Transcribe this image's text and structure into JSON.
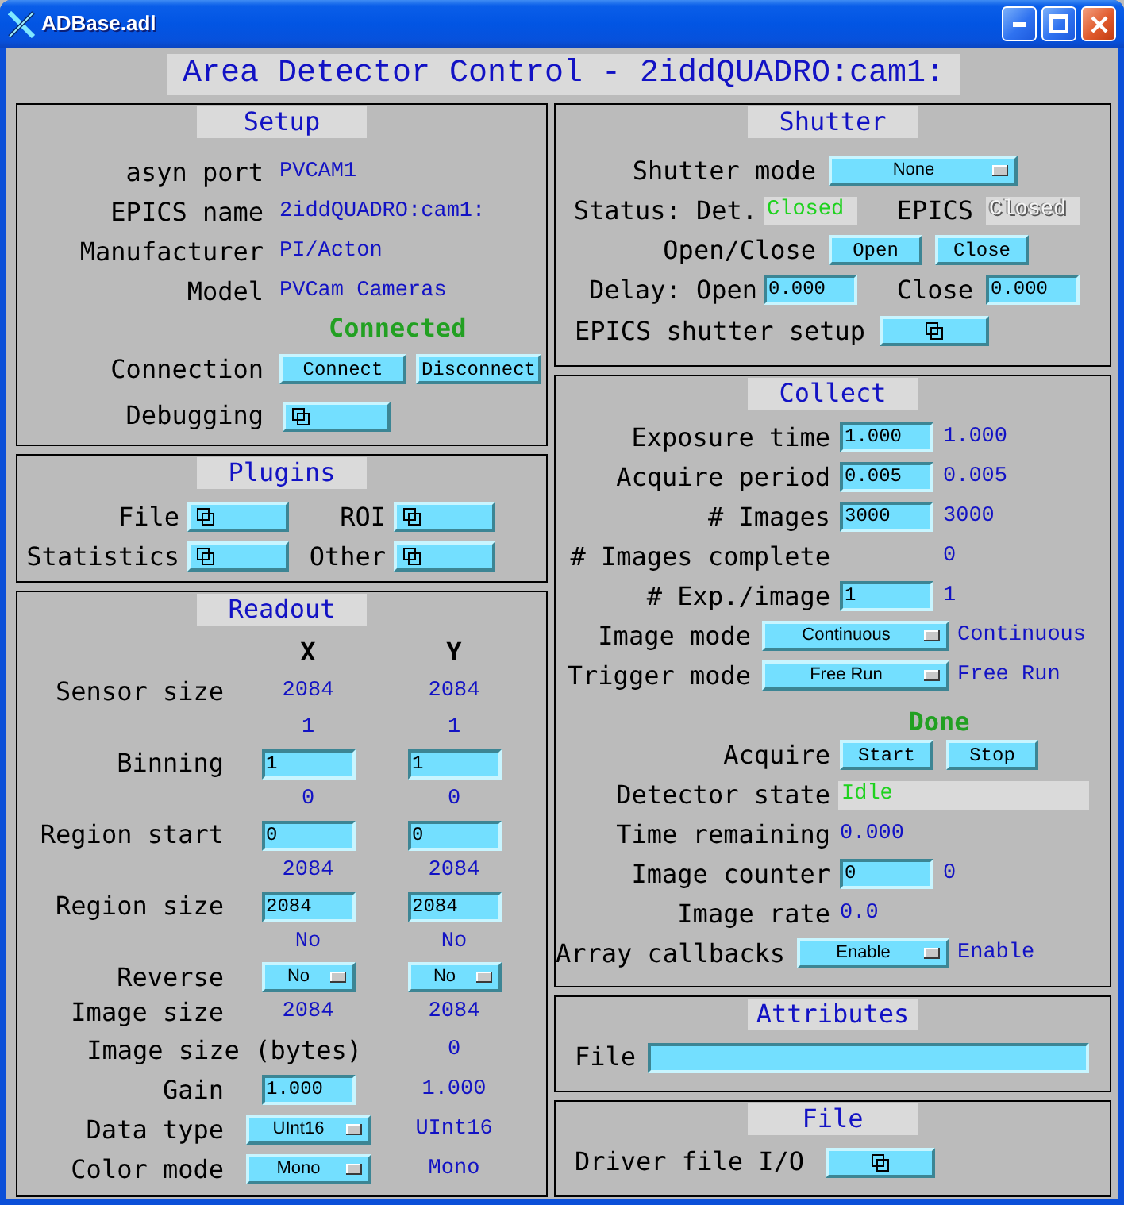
{
  "window": {
    "title": "ADBase.adl"
  },
  "display_title": "Area Detector Control - 2iddQUADRO:cam1:",
  "setup": {
    "title": "Setup",
    "rows": [
      {
        "kind": "value",
        "label": "asyn port",
        "value": "PVCAM1"
      },
      {
        "kind": "value",
        "label": "EPICS name",
        "value": "2iddQUADRO:cam1:"
      },
      {
        "kind": "value",
        "label": "Manufacturer",
        "value": "PI/Acton"
      },
      {
        "kind": "value",
        "label": "Model",
        "value": "PVCam Cameras"
      },
      {
        "kind": "status",
        "value": "Connected"
      },
      {
        "kind": "buttons",
        "label": "Connection",
        "buttons": [
          "Connect",
          "Disconnect"
        ]
      },
      {
        "kind": "related",
        "label": "Debugging"
      }
    ]
  },
  "plugins": {
    "title": "Plugins",
    "items": [
      {
        "label": "File"
      },
      {
        "label": "ROI"
      },
      {
        "label": "Statistics"
      },
      {
        "label": "Other"
      }
    ]
  },
  "readout": {
    "title": "Readout",
    "columns": [
      "X",
      "Y"
    ],
    "rows": [
      {
        "kind": "value",
        "label": "Sensor size",
        "values": [
          "2084",
          "2084"
        ]
      },
      {
        "kind": "readback",
        "values": [
          "1",
          "1"
        ]
      },
      {
        "kind": "field",
        "label": "Binning",
        "values": [
          "1",
          "1"
        ]
      },
      {
        "kind": "readback",
        "values": [
          "0",
          "0"
        ]
      },
      {
        "kind": "field",
        "label": "Region start",
        "values": [
          "0",
          "0"
        ]
      },
      {
        "kind": "readback",
        "values": [
          "2084",
          "2084"
        ]
      },
      {
        "kind": "field",
        "label": "Region size",
        "values": [
          "2084",
          "2084"
        ]
      },
      {
        "kind": "readback",
        "values": [
          "No",
          "No"
        ]
      },
      {
        "kind": "menu",
        "label": "Reverse",
        "values": [
          "No",
          "No"
        ]
      },
      {
        "kind": "value",
        "label": "Image size",
        "values": [
          "2084",
          "2084"
        ]
      },
      {
        "kind": "single",
        "label": "Image size (bytes)",
        "readback": "0"
      },
      {
        "kind": "field_readback",
        "label": "Gain",
        "value": "1.000",
        "readback": "1.000"
      },
      {
        "kind": "menu_readback",
        "label": "Data type",
        "value": "UInt16",
        "readback": "UInt16"
      },
      {
        "kind": "menu_readback",
        "label": "Color mode",
        "value": "Mono",
        "readback": "Mono"
      }
    ]
  },
  "shutter": {
    "title": "Shutter",
    "rows": [
      {
        "kind": "menu",
        "label": "Shutter mode",
        "value": "None"
      },
      {
        "kind": "status",
        "items": [
          {
            "label": "Status: Det.",
            "value": "Closed",
            "color": "#1ed21e"
          },
          {
            "label": "EPICS",
            "value": "Closed",
            "color": "#f4f4f4"
          }
        ]
      },
      {
        "kind": "buttons",
        "label": "Open/Close",
        "buttons": [
          "Open",
          "Close"
        ]
      },
      {
        "kind": "fields",
        "items": [
          {
            "label": "Delay: Open",
            "value": "0.000"
          },
          {
            "label": "Close",
            "value": "0.000"
          }
        ]
      },
      {
        "kind": "related",
        "label": "EPICS shutter setup"
      }
    ]
  },
  "collect": {
    "title": "Collect",
    "rows": [
      {
        "kind": "field",
        "label": "Exposure time",
        "value": "1.000",
        "readback": "1.000"
      },
      {
        "kind": "field",
        "label": "Acquire period",
        "value": "0.005",
        "readback": "0.005"
      },
      {
        "kind": "field",
        "label": "# Images",
        "value": "3000",
        "readback": "3000"
      },
      {
        "kind": "readback",
        "label": "# Images complete",
        "readback": "0"
      },
      {
        "kind": "field",
        "label": "# Exp./image",
        "value": "1",
        "readback": "1"
      },
      {
        "kind": "menu",
        "label": "Image mode",
        "value": "Continuous",
        "readback": "Continuous"
      },
      {
        "kind": "menu",
        "label": "Trigger mode",
        "value": "Free Run",
        "readback": "Free Run"
      },
      {
        "kind": "status",
        "value": "Done"
      },
      {
        "kind": "buttons",
        "label": "Acquire",
        "buttons": [
          "Start",
          "Stop"
        ]
      },
      {
        "kind": "indicator",
        "label": "Detector state",
        "value": "Idle"
      },
      {
        "kind": "value",
        "label": "Time remaining",
        "value": "0.000"
      },
      {
        "kind": "field",
        "label": "Image counter",
        "value": "0",
        "readback": "0"
      },
      {
        "kind": "value",
        "label": "Image rate",
        "value": "0.0"
      },
      {
        "kind": "menu",
        "label": "Array callbacks",
        "value": "Enable",
        "readback": "Enable"
      }
    ]
  },
  "attributes": {
    "title": "Attributes",
    "label": "File"
  },
  "file": {
    "title": "File",
    "label": "Driver file I/O"
  }
}
